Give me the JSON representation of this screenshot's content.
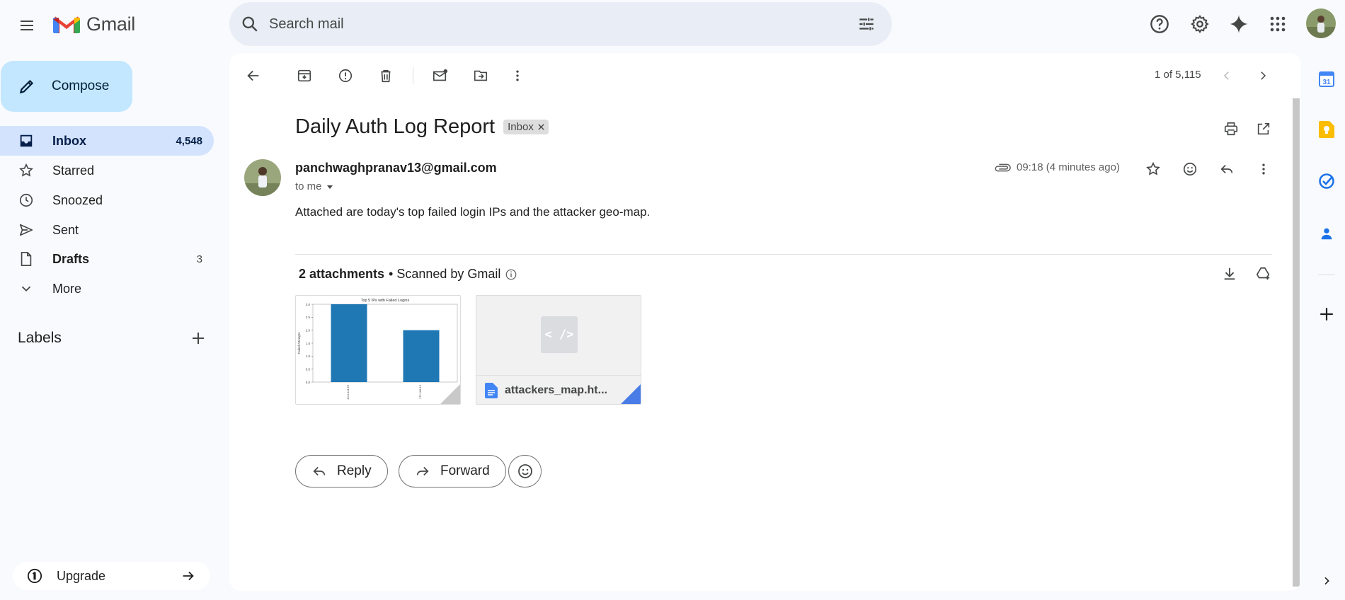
{
  "app": {
    "brand": "Gmail"
  },
  "search": {
    "placeholder": "Search mail"
  },
  "compose": {
    "label": "Compose"
  },
  "nav": [
    {
      "label": "Inbox",
      "count": "4,548"
    },
    {
      "label": "Starred",
      "count": ""
    },
    {
      "label": "Snoozed",
      "count": ""
    },
    {
      "label": "Sent",
      "count": ""
    },
    {
      "label": "Drafts",
      "count": "3"
    },
    {
      "label": "More",
      "count": ""
    }
  ],
  "labels": {
    "title": "Labels"
  },
  "upgrade": {
    "label": "Upgrade"
  },
  "toolbar": {
    "pager": "1 of 5,115"
  },
  "email": {
    "subject": "Daily Auth Log Report",
    "label_chip": "Inbox",
    "sender": "panchwaghpranav13@gmail.com",
    "recipient": "to me",
    "time": "09:18 (4 minutes ago)",
    "body": "Attached are today's top failed login IPs and the attacker geo-map."
  },
  "attachments": {
    "count_label": "2 attachments",
    "scan_label": "• Scanned by Gmail",
    "items": [
      {
        "type": "image",
        "chart_data": {
          "type": "bar",
          "title": "Top 5 IPs with Failed Logins",
          "ylabel": "Failed Attempts",
          "yticks": [
            "0.0",
            "0.5",
            "1.0",
            "1.5",
            "2.0",
            "2.5",
            "3.0"
          ],
          "ylim": [
            0,
            3.0
          ],
          "categories": [
            "10.0.114.55",
            "172.168.15"
          ],
          "values": [
            3,
            2
          ]
        }
      },
      {
        "type": "html",
        "name": "attackers_map.ht...",
        "preview_glyph": "< />"
      }
    ]
  },
  "actions": {
    "reply": "Reply",
    "forward": "Forward"
  },
  "colors": {
    "compose_bg": "#c2e7ff",
    "active_nav": "#d3e3fd",
    "bar": "#1f77b4",
    "search_bg": "#e9eef6"
  }
}
